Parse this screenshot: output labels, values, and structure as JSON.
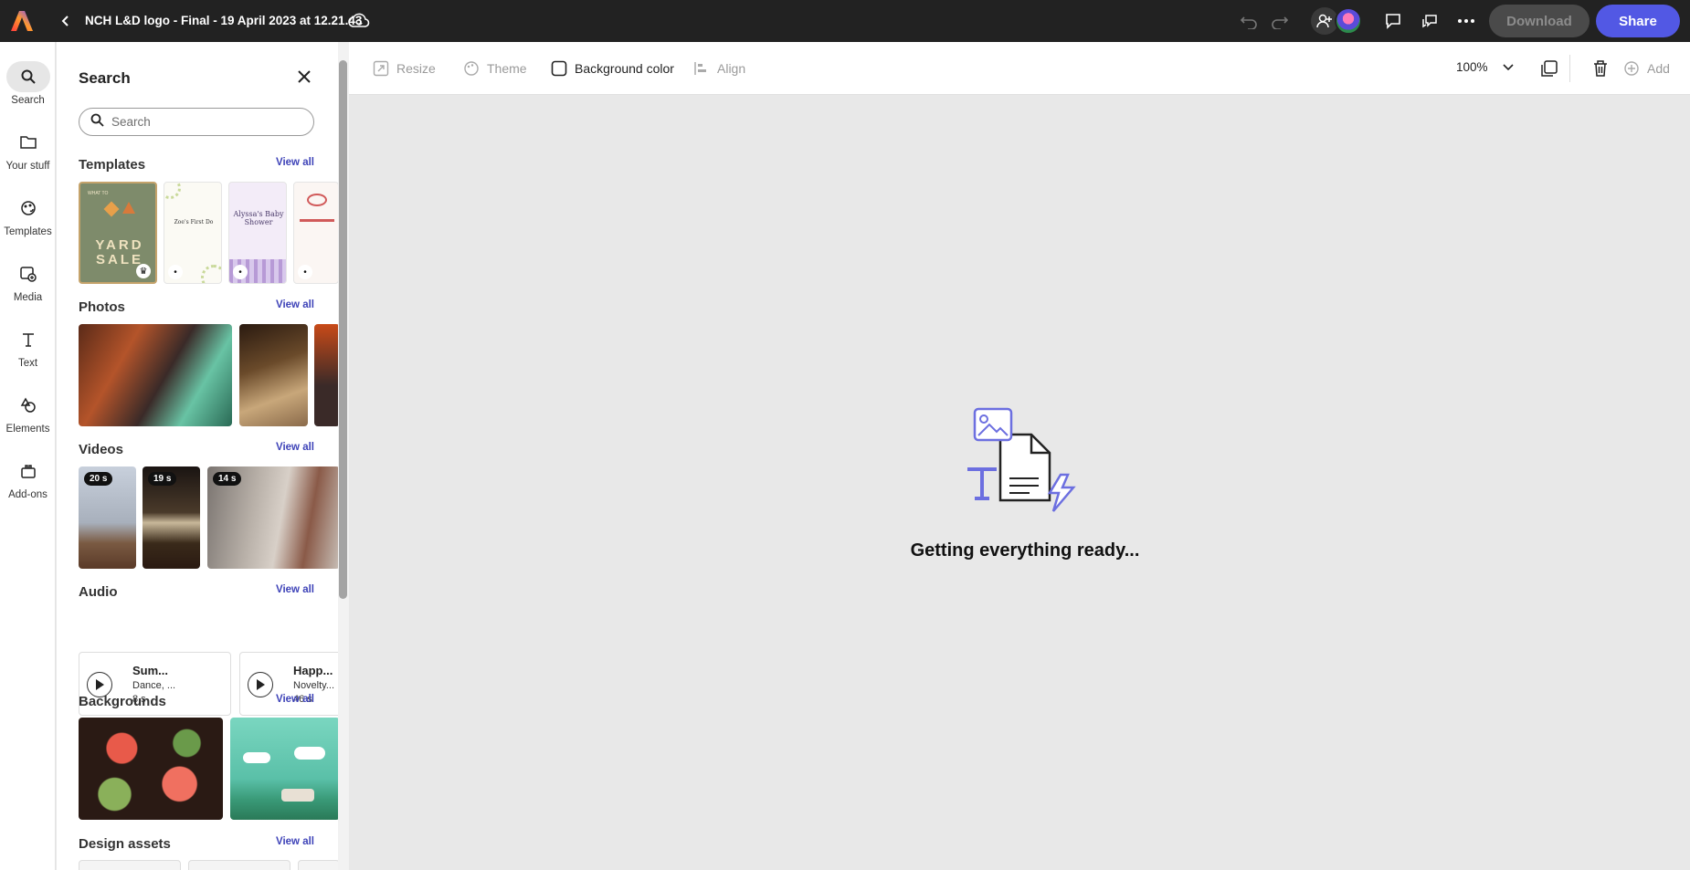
{
  "topbar": {
    "doc_title": "NCH L&D logo - Final - 19 April 2023 at 12.21.43",
    "download_label": "Download",
    "share_label": "Share"
  },
  "rail": {
    "items": [
      {
        "label": "Search",
        "icon": "search-icon"
      },
      {
        "label": "Your stuff",
        "icon": "folder-icon"
      },
      {
        "label": "Templates",
        "icon": "templates-icon"
      },
      {
        "label": "Media",
        "icon": "media-icon"
      },
      {
        "label": "Text",
        "icon": "text-icon"
      },
      {
        "label": "Elements",
        "icon": "elements-icon"
      },
      {
        "label": "Add-ons",
        "icon": "addons-icon"
      }
    ]
  },
  "panel": {
    "title": "Search",
    "search_placeholder": "Search",
    "view_all": "View all",
    "sections": {
      "templates": "Templates",
      "photos": "Photos",
      "videos": "Videos",
      "audio": "Audio",
      "backgrounds": "Backgrounds",
      "design_assets": "Design assets"
    },
    "template_cards": [
      {
        "title": "YARD SALE",
        "sub": "WHAT TO"
      },
      {
        "title": "Zoe's First Do",
        "sub": ""
      },
      {
        "title": "Alyssa's Baby Shower",
        "sub": ""
      },
      {
        "title": "",
        "sub": ""
      }
    ],
    "videos": [
      {
        "duration": "20 s"
      },
      {
        "duration": "19 s"
      },
      {
        "duration": "14 s"
      }
    ],
    "audio": [
      {
        "title": "Sum...",
        "genre": "Dance, ...",
        "duration": "8 s"
      },
      {
        "title": "Happ...",
        "genre": "Novelty...",
        "duration": "46 s"
      }
    ]
  },
  "propbar": {
    "resize": "Resize",
    "theme": "Theme",
    "background_color": "Background color",
    "align": "Align",
    "zoom": "100%",
    "add": "Add"
  },
  "canvas": {
    "loading_text": "Getting everything ready..."
  }
}
